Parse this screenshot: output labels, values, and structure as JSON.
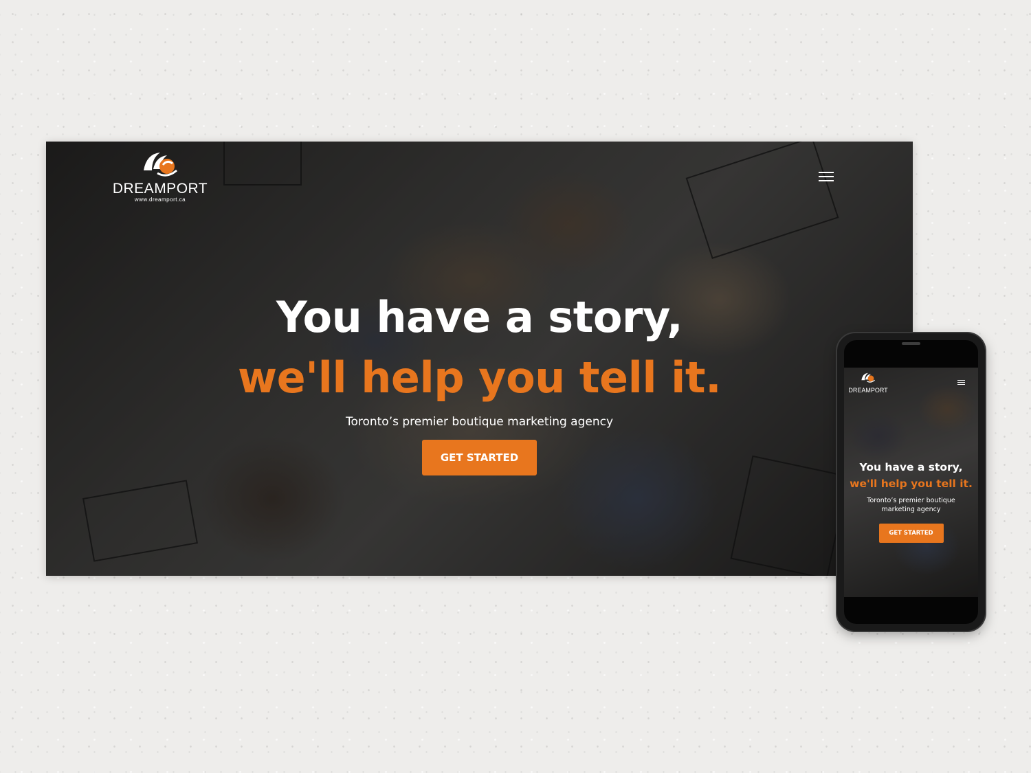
{
  "desktop": {
    "logo": {
      "wordmark": "DREAMPORT",
      "url": "www.dreamport.ca",
      "icon": "dreamport-logo-mark"
    },
    "menu_icon": "hamburger-menu-icon",
    "hero": {
      "line1": "You have a story,",
      "line2": "we'll help you tell it.",
      "subtitle": "Toronto’s premier boutique marketing agency",
      "cta_label": "GET STARTED"
    }
  },
  "mobile": {
    "logo": {
      "wordmark": "DREAMPORT",
      "icon": "dreamport-logo-mark"
    },
    "menu_icon": "hamburger-menu-icon",
    "hero": {
      "line1": "You have a story,",
      "line2": "we'll help you tell it.",
      "subtitle": "Toronto’s premier boutique marketing agency",
      "cta_label": "GET STARTED"
    }
  },
  "colors": {
    "accent": "#e8761e",
    "hero_text": "#ffffff",
    "backdrop": "#eeedeb"
  }
}
